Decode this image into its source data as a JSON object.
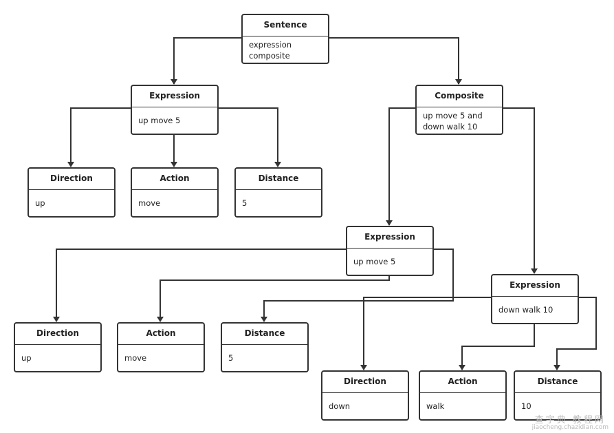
{
  "nodes": {
    "sentence": {
      "title": "Sentence",
      "lines": [
        "expression",
        "composite"
      ]
    },
    "expression1": {
      "title": "Expression",
      "lines": [
        "up move 5"
      ]
    },
    "composite": {
      "title": "Composite",
      "lines": [
        "up move 5 and",
        "down walk 10"
      ]
    },
    "direction1": {
      "title": "Direction",
      "lines": [
        "up"
      ]
    },
    "action1": {
      "title": "Action",
      "lines": [
        "move"
      ]
    },
    "distance1": {
      "title": "Distance",
      "lines": [
        "5"
      ]
    },
    "expression2": {
      "title": "Expression",
      "lines": [
        "up move 5"
      ]
    },
    "expression3": {
      "title": "Expression",
      "lines": [
        "down walk 10"
      ]
    },
    "direction2": {
      "title": "Direction",
      "lines": [
        "up"
      ]
    },
    "action2": {
      "title": "Action",
      "lines": [
        "move"
      ]
    },
    "distance2": {
      "title": "Distance",
      "lines": [
        "5"
      ]
    },
    "direction3": {
      "title": "Direction",
      "lines": [
        "down"
      ]
    },
    "action3": {
      "title": "Action",
      "lines": [
        "walk"
      ]
    },
    "distance3": {
      "title": "Distance",
      "lines": [
        "10"
      ]
    }
  },
  "edges": [
    [
      "sentence",
      "expression1"
    ],
    [
      "sentence",
      "composite"
    ],
    [
      "expression1",
      "direction1"
    ],
    [
      "expression1",
      "action1"
    ],
    [
      "expression1",
      "distance1"
    ],
    [
      "composite",
      "expression2"
    ],
    [
      "composite",
      "expression3"
    ],
    [
      "expression2",
      "direction2"
    ],
    [
      "expression2",
      "action2"
    ],
    [
      "expression2",
      "distance2"
    ],
    [
      "expression3",
      "direction3"
    ],
    [
      "expression3",
      "action3"
    ],
    [
      "expression3",
      "distance3"
    ]
  ],
  "watermark": {
    "line1": "查字典 教程网",
    "line2": "jiaocheng.chazidian.com"
  }
}
